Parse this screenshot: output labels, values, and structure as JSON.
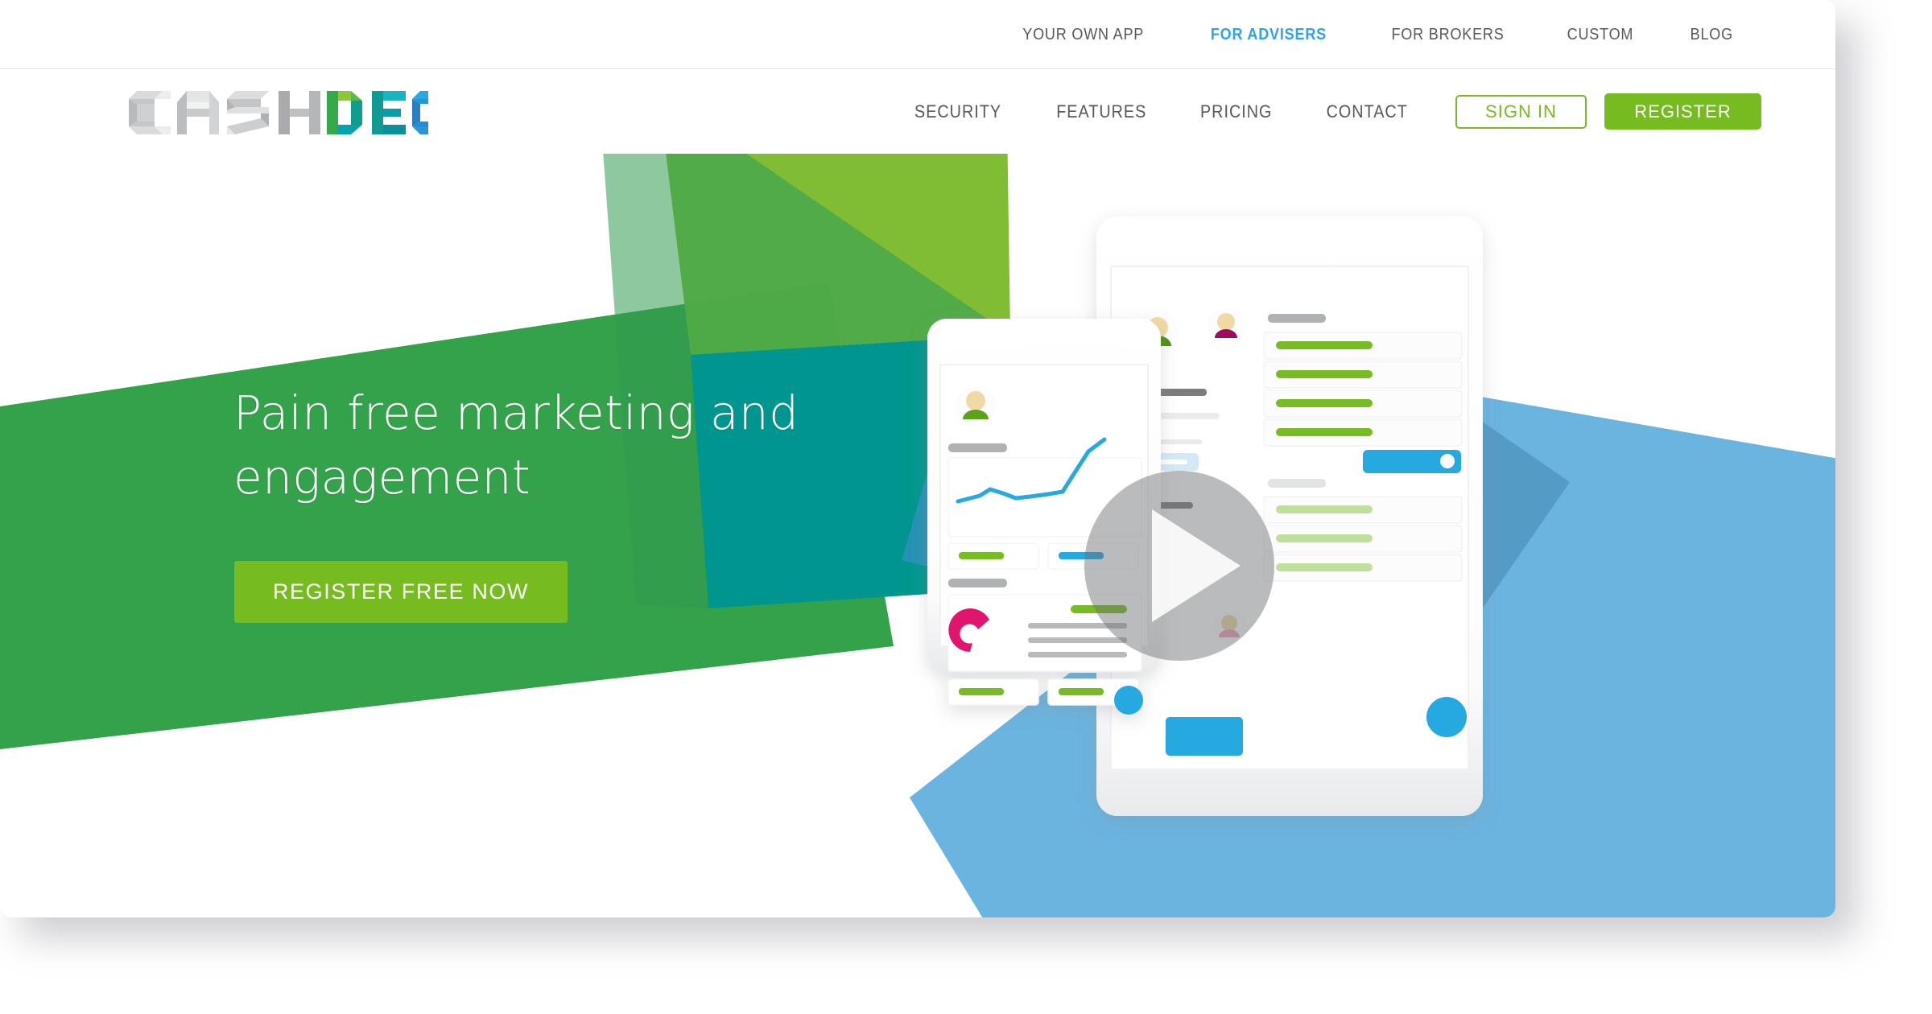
{
  "utility_nav": {
    "items": [
      {
        "label": "YOUR OWN APP",
        "active": false
      },
      {
        "label": "FOR ADVISERS",
        "active": true
      },
      {
        "label": "FOR BROKERS",
        "active": false
      },
      {
        "label": "CUSTOM",
        "active": false
      },
      {
        "label": "BLOG",
        "active": false
      }
    ]
  },
  "brand": {
    "name": "CASHDECK",
    "part_light": "CASH",
    "part_color": "DECK"
  },
  "main_nav": {
    "items": [
      {
        "label": "SECURITY"
      },
      {
        "label": "FEATURES"
      },
      {
        "label": "PRICING"
      },
      {
        "label": "CONTACT"
      }
    ],
    "sign_in_label": "SIGN IN",
    "register_label": "REGISTER"
  },
  "hero": {
    "title": "Pain free marketing and\nengagement",
    "cta_label": "REGISTER FREE NOW",
    "play_label": "Play video"
  },
  "colors": {
    "brand_green": "#76bc21",
    "band_green": "#34a14b",
    "leaf_green": "#7ab929",
    "teal": "#00968f",
    "sky_blue": "#6ab4e0",
    "bright_blue": "#2ea3e8",
    "magenta": "#e0146e",
    "accent_blue_link": "#2ea3e8",
    "text_gray": "#58585a"
  }
}
